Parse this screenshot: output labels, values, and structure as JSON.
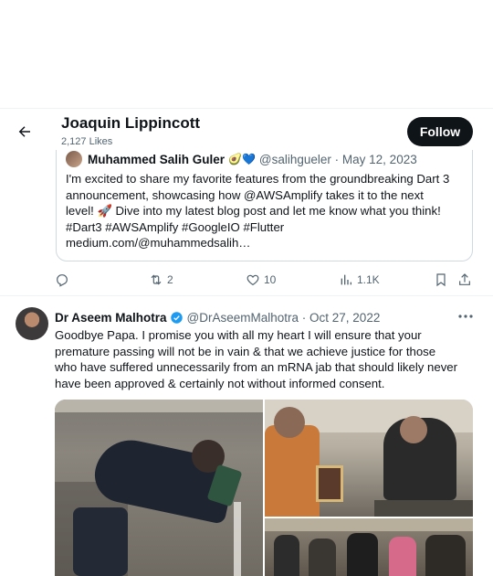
{
  "header": {
    "name": "Joaquin Lippincott",
    "likes_count": "2,127 Likes",
    "follow_label": "Follow"
  },
  "quoted_tweet": {
    "author_name": "Muhammed Salih Guler",
    "author_emoji": "🥑💙",
    "handle_date": "@salihgueler · May 12, 2023",
    "lines": [
      "I'm excited to share my favorite features from the groundbreaking Dart 3",
      "announcement, showcasing how @AWSAmplify takes it to the next",
      "level! 🚀 Dive into my latest blog post and let me know what you think!",
      "#Dart3 #AWSAmplify #GoogleIO #Flutter",
      "medium.com/@muhammedsalih…"
    ]
  },
  "actions": {
    "reply_count": "",
    "retweet_count": "2",
    "like_count": "10",
    "views_count": "1.1K"
  },
  "tweet": {
    "author_name": "Dr Aseem Malhotra",
    "handle_date": "@DrAseemMalhotra · Oct 27, 2022",
    "lines": [
      "Goodbye Papa. I promise you with all my heart I will ensure that your",
      "premature passing will not be in vain & that we achieve justice for those",
      "who have suffered unnecessarily from an mRNA jab that should likely never",
      "have been approved & certainly not without informed consent."
    ]
  },
  "colors": {
    "text": "#0f1419",
    "secondary": "#536471",
    "border": "#cfd9de",
    "verified": "#1d9bf0"
  }
}
